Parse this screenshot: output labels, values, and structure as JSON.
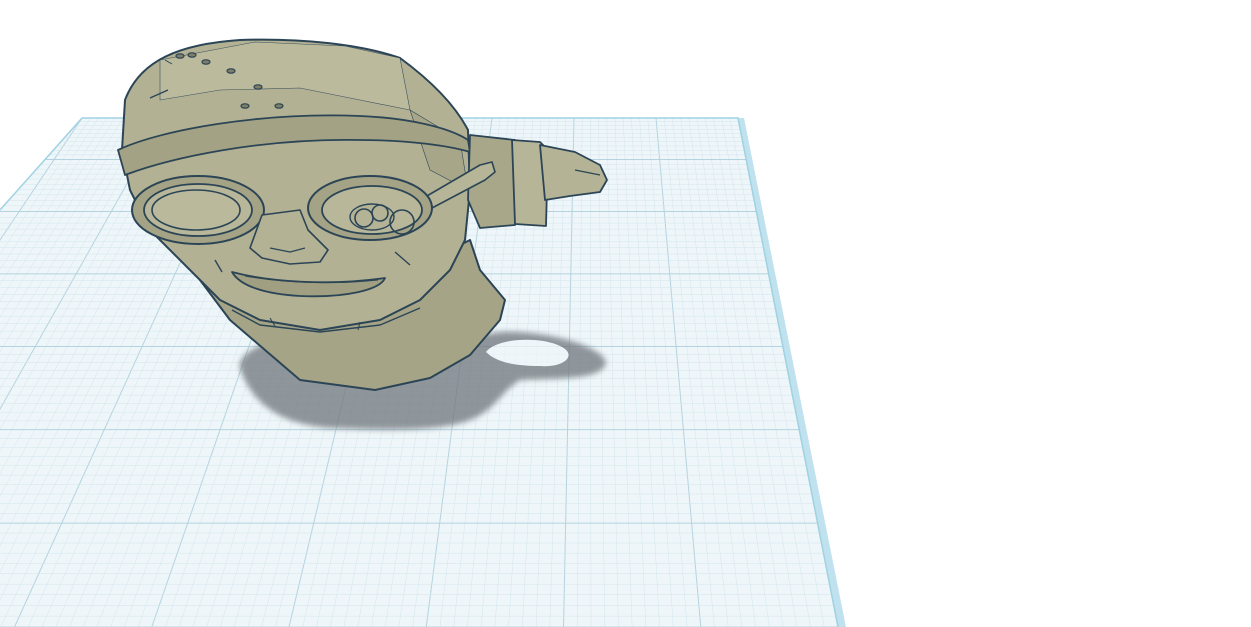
{
  "app": {
    "view": "3d-workplane",
    "background_color": "#ffffff"
  },
  "workplane": {
    "grid_color_minor": "#d3e6ee",
    "grid_color_major": "#b5d3df",
    "plane_fill": "#eef6f9",
    "edge_color": "#9fd2e2",
    "edge_highlight": "#c9e9f2"
  },
  "model": {
    "name": "head-with-goggles",
    "fill_color": "#b0ae8f",
    "shade_color": "#9c9a7b",
    "highlight_color": "#c2c0a3",
    "outline_color": "#2b4556",
    "shadow_color": "#6a7176"
  }
}
